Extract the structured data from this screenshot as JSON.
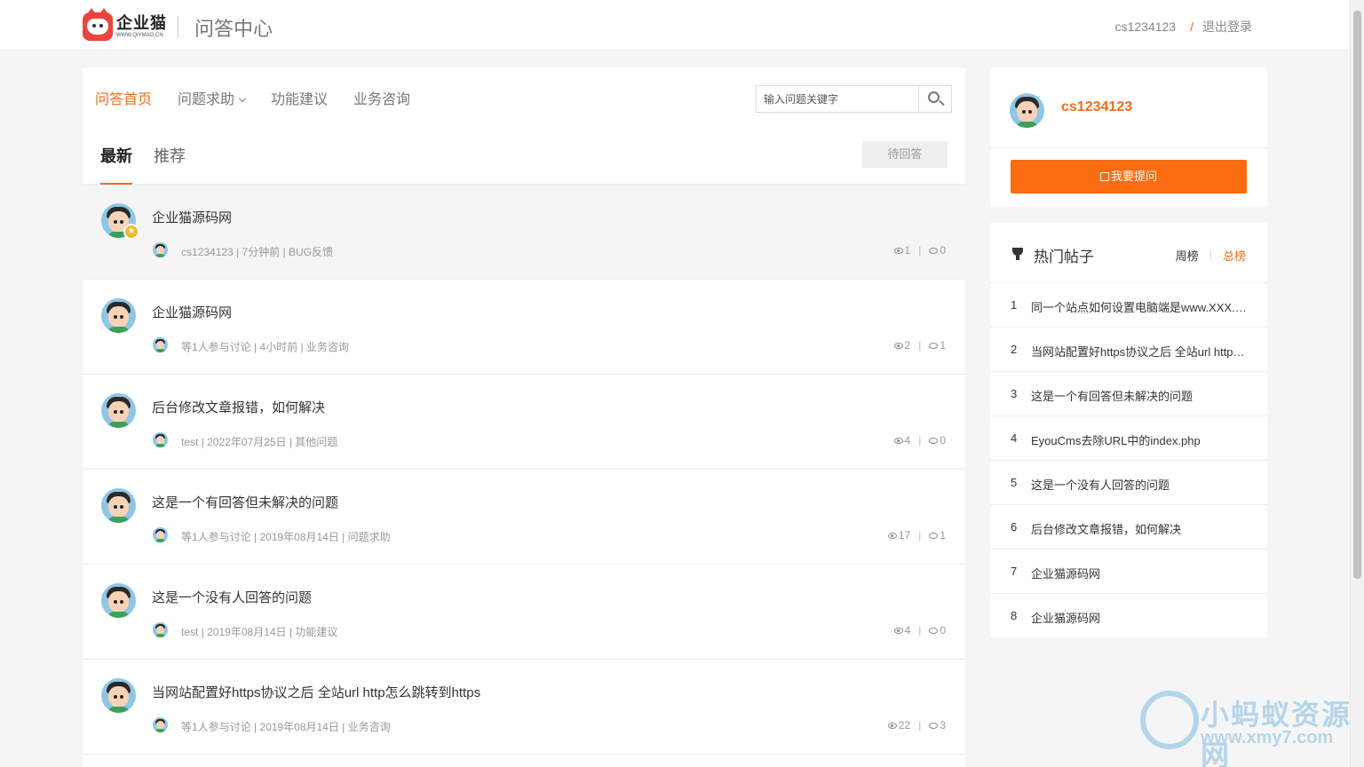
{
  "header": {
    "logo_text": "企业猫",
    "logo_sub": "WWW.QIYMAO.CN",
    "site_title": "问答中心",
    "username": "cs1234123",
    "slash": "/",
    "logout": "退出登录"
  },
  "nav": {
    "items": [
      "问答首页",
      "问题求助",
      "功能建议",
      "业务咨询"
    ],
    "active_index": 0
  },
  "search": {
    "placeholder": "输入问题关键字"
  },
  "tabs": {
    "latest": "最新",
    "recommended": "推荐",
    "wait_button": "待回答"
  },
  "questions": [
    {
      "title": "企业猫源码网",
      "meta": "cs1234123 | 7分钟前 | BUG反馈",
      "views": "1",
      "comments": "0",
      "badge": true
    },
    {
      "title": "企业猫源码网",
      "meta": "等1人参与讨论 | 4小时前 | 业务咨询",
      "views": "2",
      "comments": "1"
    },
    {
      "title": "后台修改文章报错，如何解决",
      "meta": "test | 2022年07月25日 | 其他问题",
      "views": "4",
      "comments": "0"
    },
    {
      "title": "这是一个有回答但未解决的问题",
      "meta": "等1人参与讨论 | 2019年08月14日 | 问题求助",
      "views": "17",
      "comments": "1"
    },
    {
      "title": "这是一个没有人回答的问题",
      "meta": "test | 2019年08月14日 | 功能建议",
      "views": "4",
      "comments": "0"
    },
    {
      "title": "当网站配置好https协议之后 全站url http怎么跳转到https",
      "meta": "等1人参与讨论 | 2019年08月14日 | 业务咨询",
      "views": "22",
      "comments": "3"
    }
  ],
  "sidebar": {
    "username": "cs1234123",
    "ask_button": "我要提问",
    "hot": {
      "title": "热门帖子",
      "tab_week": "周榜",
      "tab_sep": "|",
      "tab_total": "总榜",
      "items": [
        {
          "num": "1",
          "text": "同一个站点如何设置电脑端是www.XXX.com，手机端是m.XXX.com"
        },
        {
          "num": "2",
          "text": "当网站配置好https协议之后 全站url http怎么跳转到https"
        },
        {
          "num": "3",
          "text": "这是一个有回答但未解决的问题"
        },
        {
          "num": "4",
          "text": "EyouCms去除URL中的index.php"
        },
        {
          "num": "5",
          "text": "这是一个没有人回答的问题"
        },
        {
          "num": "6",
          "text": "后台修改文章报错，如何解决"
        },
        {
          "num": "7",
          "text": "企业猫源码网"
        },
        {
          "num": "8",
          "text": "企业猫源码网"
        }
      ]
    }
  },
  "watermark": {
    "line1": "小蚂蚁资源网",
    "line2": "www.xmy7.com"
  },
  "colors": {
    "accent": "#f06c1e",
    "button": "#f96c12"
  }
}
